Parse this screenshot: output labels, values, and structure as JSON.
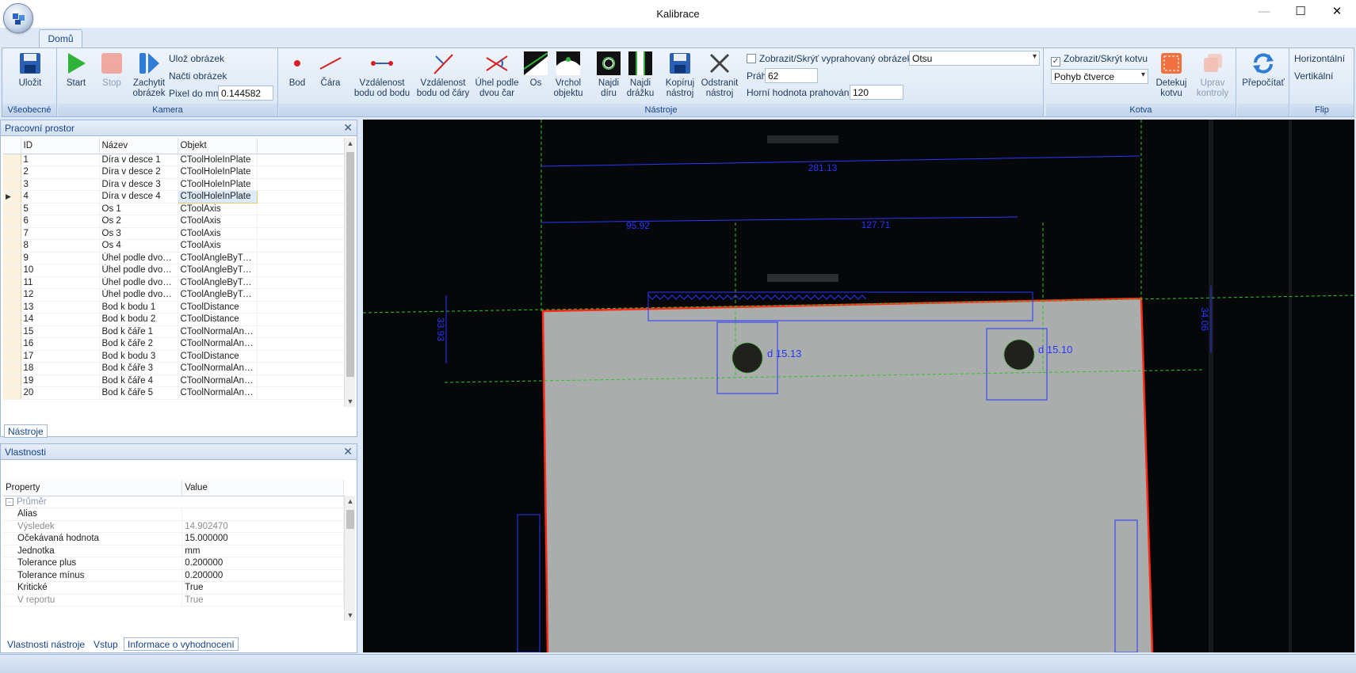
{
  "window": {
    "title": "Kalibrace",
    "min": "—",
    "max": "☐",
    "close": "✕"
  },
  "ribbon": {
    "tab": "Domů",
    "groups": {
      "general": {
        "title": "Všeobecné",
        "save": "Uložit"
      },
      "camera": {
        "title": "Kamera",
        "start": "Start",
        "stop": "Stop",
        "capture": "Zachytit obrázek",
        "save_image": "Ulož obrázek",
        "load_image": "Načti obrázek",
        "pixel_label": "Pixel do mm",
        "pixel_value": "0.144582"
      },
      "tools": {
        "title": "Nástroje",
        "buttons": [
          "Bod",
          "Čára",
          "Vzdálenost bodu od bodu",
          "Vzdálenost bodu od čáry",
          "Úhel podle dvou čar",
          "Os",
          "Vrchol objektu",
          "Najdi díru",
          "Najdi drážku",
          "Kopíruj nástroj",
          "Odstranit nástroj"
        ],
        "show_threshold_label": "Zobrazit/Skrýť vyprahovaný obrázek",
        "threshold_method": "Otsu",
        "threshold_label": "Práh",
        "threshold_value": "62",
        "upper_threshold_label": "Horní hodnota prahování",
        "upper_threshold_value": "120"
      },
      "anchor": {
        "title": "Kotva",
        "show_anchor_label": "Zobrazit/Skrýt kotvu",
        "show_anchor_checked": true,
        "mode": "Pohyb čtverce",
        "detect": "Detekuj kotvu",
        "edit": "Uprav kontroly"
      },
      "recalc": {
        "label": "Přepočítať"
      },
      "flip": {
        "title": "Flip",
        "horizontal": "Horizontální",
        "vertical": "Vertikální"
      }
    }
  },
  "workspace": {
    "title": "Pracovní prostor",
    "columns": [
      "ID",
      "Název",
      "Objekt"
    ],
    "rows": [
      [
        "1",
        "Díra v desce 1",
        "CToolHoleInPlate"
      ],
      [
        "2",
        "Díra v desce 2",
        "CToolHoleInPlate"
      ],
      [
        "3",
        "Díra v desce 3",
        "CToolHoleInPlate"
      ],
      [
        "4",
        "Díra v desce 4",
        "CToolHoleInPlate"
      ],
      [
        "5",
        "Os 1",
        "CToolAxis"
      ],
      [
        "6",
        "Os 2",
        "CToolAxis"
      ],
      [
        "7",
        "Os 3",
        "CToolAxis"
      ],
      [
        "8",
        "Os 4",
        "CToolAxis"
      ],
      [
        "9",
        "Úhel podle dvou ...",
        "CToolAngleByTw..."
      ],
      [
        "10",
        "Úhel podle dvou ...",
        "CToolAngleByTw..."
      ],
      [
        "11",
        "Úhel podle dvou ...",
        "CToolAngleByTw..."
      ],
      [
        "12",
        "Úhel podle dvou ...",
        "CToolAngleByTw..."
      ],
      [
        "13",
        "Bod k bodu 1",
        "CToolDistance"
      ],
      [
        "14",
        "Bod k bodu 2",
        "CToolDistance"
      ],
      [
        "15",
        "Bod k čáře 1",
        "CToolNormalAnd..."
      ],
      [
        "16",
        "Bod k čáře 2",
        "CToolNormalAnd..."
      ],
      [
        "17",
        "Bod k bodu 3",
        "CToolDistance"
      ],
      [
        "18",
        "Bod k čáře 3",
        "CToolNormalAnd..."
      ],
      [
        "19",
        "Bod k čáře 4",
        "CToolNormalAnd..."
      ],
      [
        "20",
        "Bod k čáře 5",
        "CToolNormalAnd..."
      ]
    ],
    "selected_row": 3,
    "bottom_tab": "Nástroje"
  },
  "properties": {
    "title": "Vlastnosti",
    "columns": [
      "Property",
      "Value"
    ],
    "category": "Průměr",
    "rows": [
      [
        "Alias",
        ""
      ],
      [
        "Výsledek",
        "14.902470"
      ],
      [
        "Očekávaná hodnota",
        "15.000000"
      ],
      [
        "Jednotka",
        "mm"
      ],
      [
        "Tolerance plus",
        "0.200000"
      ],
      [
        "Tolerance mínus",
        "0.200000"
      ],
      [
        "Kritické",
        "True"
      ],
      [
        "V reportu",
        "True"
      ]
    ],
    "bottom_tabs": [
      "Vlastnosti nástroje",
      "Vstup",
      "Informace o vyhodnocení"
    ]
  },
  "image": {
    "dims": [
      "281.13",
      "95.92",
      "127.71",
      "33.93",
      "34.06"
    ],
    "holes": [
      "d 15.13",
      "d 15.10"
    ]
  },
  "colors": {
    "accent": "#15428b",
    "measure": "#2a35ff",
    "edge": "#ff2a1a",
    "axis": "#33c02a"
  }
}
